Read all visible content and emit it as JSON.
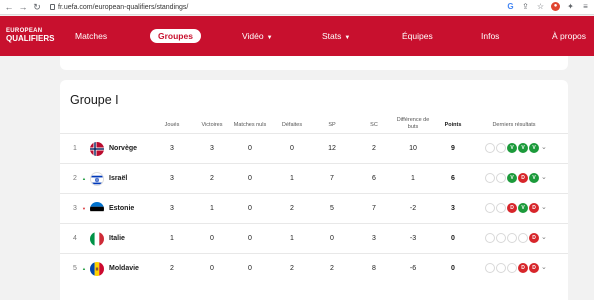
{
  "browser": {
    "url": "fr.uefa.com/european-qualifiers/standings/",
    "back_icon": "←",
    "forward_icon": "→",
    "reload_icon": "↻"
  },
  "header": {
    "logo_line1": "EUROPEAN",
    "logo_line2": "QUALIFIERS",
    "nav": [
      {
        "label": "Matches",
        "caret": ""
      },
      {
        "label": "Groupes",
        "caret": ""
      },
      {
        "label": "Vidéo",
        "caret": "▼"
      },
      {
        "label": "Stats",
        "caret": "▼"
      },
      {
        "label": "Équipes",
        "caret": ""
      },
      {
        "label": "Infos",
        "caret": ""
      },
      {
        "label": "À propos",
        "caret": ""
      }
    ],
    "active_color": "#c8102e"
  },
  "group": {
    "title": "Groupe I",
    "columns": {
      "played": "Joués",
      "wins": "Victoires",
      "draws": "Matches nuls",
      "losses": "Défaites",
      "gf": "SP",
      "ga": "SC",
      "gd_line1": "Différence de",
      "gd_line2": "buts",
      "points": "Points",
      "last": "Derniers résultats"
    },
    "rows": [
      {
        "pos": "1",
        "arrow": "",
        "team": "Norvège",
        "played": "3",
        "wins": "3",
        "draws": "0",
        "losses": "0",
        "gf": "12",
        "ga": "2",
        "gd": "10",
        "points": "9",
        "results": [
          "",
          "",
          "V",
          "V",
          "V"
        ]
      },
      {
        "pos": "2",
        "arrow": "▲",
        "team": "Israël",
        "played": "3",
        "wins": "2",
        "draws": "0",
        "losses": "1",
        "gf": "7",
        "ga": "6",
        "gd": "1",
        "points": "6",
        "results": [
          "",
          "",
          "V",
          "D",
          "V"
        ]
      },
      {
        "pos": "3",
        "arrow": "▼",
        "team": "Estonie",
        "played": "3",
        "wins": "1",
        "draws": "0",
        "losses": "2",
        "gf": "5",
        "ga": "7",
        "gd": "-2",
        "points": "3",
        "results": [
          "",
          "",
          "D",
          "V",
          "D"
        ]
      },
      {
        "pos": "4",
        "arrow": "",
        "team": "Italie",
        "played": "1",
        "wins": "0",
        "draws": "0",
        "losses": "1",
        "gf": "0",
        "ga": "3",
        "gd": "-3",
        "points": "0",
        "results": [
          "",
          "",
          "",
          "",
          "D"
        ]
      },
      {
        "pos": "5",
        "arrow": "▲",
        "team": "Moldavie",
        "played": "2",
        "wins": "0",
        "draws": "0",
        "losses": "2",
        "gf": "2",
        "ga": "8",
        "gd": "-6",
        "points": "0",
        "results": [
          "",
          "",
          "",
          "D",
          "D"
        ]
      }
    ]
  }
}
